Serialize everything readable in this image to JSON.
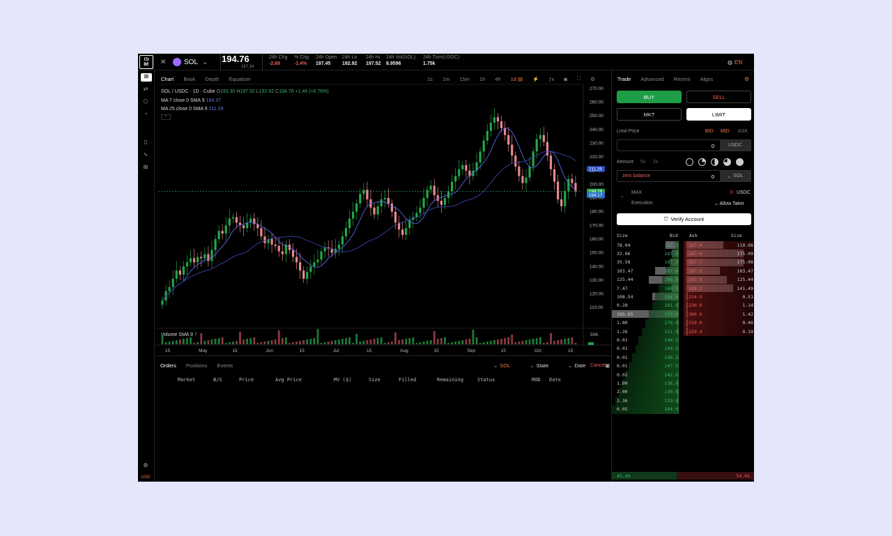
{
  "header": {
    "logo": "CU\nBE",
    "symbol": "SOL",
    "price": "194.76",
    "price_sub": "187.34",
    "lang": "EN",
    "stats": [
      {
        "label": "24h Chg",
        "value": "-2.69",
        "color": "#f05a5a"
      },
      {
        "label": "% Chg",
        "value": "-1.4%",
        "color": "#f05a5a"
      },
      {
        "label": "24h Open",
        "value": "197.45",
        "color": "#eeeeee"
      },
      {
        "label": "24h Lo",
        "value": "192.92",
        "color": "#eeeeee"
      },
      {
        "label": "24h Hi",
        "value": "197.52",
        "color": "#eeeeee"
      },
      {
        "label": "24h Vol(SOL)",
        "value": "8.9596",
        "color": "#eeeeee"
      },
      {
        "label": "24h Turn(USDC)",
        "value": "1.75k",
        "color": "#eeeeee"
      }
    ]
  },
  "chart_tabs": [
    "Chart",
    "Book",
    "Depth",
    "Equalizer"
  ],
  "timeframes": [
    "1s",
    "1m",
    "15m",
    "1h",
    "4h",
    "1d"
  ],
  "legend": {
    "pair": "SOL / USDC · 1D · Cube",
    "o": "193.30",
    "h": "197.52",
    "l": "192.92",
    "c": "194.76",
    "chg": "+1.46 (+0.76%)",
    "ma7": "MA 7 close 0 SMA 9",
    "ma7v": "194.37",
    "ma25": "MA 25 close 0 SMA 9",
    "ma25v": "211.29",
    "vol": "Volume SMA 9",
    "volv": "7"
  },
  "chart_data": {
    "type": "candlestick",
    "y_axis": [
      "270.00",
      "260.00",
      "250.00",
      "240.00",
      "230.00",
      "220.00",
      "210.00",
      "200.00",
      "190.00",
      "180.00",
      "170.00",
      "160.00",
      "150.00",
      "140.00",
      "130.00",
      "120.00",
      "110.00"
    ],
    "ylim": [
      105,
      271
    ],
    "x_labels": [
      "15",
      "May",
      "15",
      "Jun",
      "15",
      "Jul",
      "15",
      "Aug",
      "15",
      "Sep",
      "15",
      "Oct",
      "15"
    ],
    "price_tags": [
      "211.29",
      "194.76",
      "194.17"
    ],
    "vol_label": "50K",
    "closes": [
      115,
      122,
      125,
      131,
      137,
      134,
      140,
      143,
      146,
      143,
      147,
      146,
      149,
      144,
      152,
      160,
      166,
      164,
      170,
      175,
      176,
      172,
      170,
      168,
      172,
      175,
      171,
      168,
      162,
      157,
      160,
      156,
      155,
      151,
      149,
      156,
      152,
      147,
      143,
      137,
      131,
      136,
      140,
      143,
      145,
      151,
      154,
      153,
      150,
      153,
      156,
      162,
      168,
      175,
      180,
      186,
      193,
      196,
      189,
      183,
      178,
      184,
      189,
      190,
      186,
      180,
      172,
      167,
      163,
      168,
      174,
      176,
      179,
      183,
      190,
      196,
      199,
      192,
      188,
      185,
      190,
      195,
      202,
      206,
      211,
      214,
      210,
      206,
      210,
      216,
      224,
      232,
      239,
      245,
      249,
      246,
      241,
      236,
      229,
      221,
      213,
      206,
      201,
      205,
      213,
      224,
      233,
      236,
      231,
      221,
      211,
      202,
      189,
      184,
      195,
      204,
      201,
      195
    ]
  },
  "orders": {
    "tabs": [
      "Orders",
      "Positions",
      "Events"
    ],
    "filters": [
      "SOL",
      "State",
      "Date"
    ],
    "cancel": "Cancel",
    "columns": [
      "Market",
      "B/S",
      "Price",
      "Avg Price",
      "MV ($)",
      "Size",
      "Filled",
      "Remaining",
      "Status",
      "MOD",
      "Date"
    ]
  },
  "trade": {
    "tabs": [
      "Trade",
      "Advanced",
      "Recent",
      "Algos"
    ],
    "buy": "BUY",
    "sell": "SELL",
    "mkt": "MKT",
    "limit": "LIMIT",
    "limit_price": "Limit Price",
    "bid": "BID",
    "mid": "MID",
    "ask": "ASK",
    "price_val": "0",
    "price_unit": "USDC",
    "amount": "Amount",
    "x5": "5x",
    "x2": "2x",
    "zero_balance": "zero balance",
    "amount_val": "0",
    "amount_unit": "SOL",
    "max": "MAX",
    "max_val": "0",
    "max_unit": "USDC",
    "execution": "Execution",
    "allow_taker": "Allow Taker",
    "verify": "Verify Account"
  },
  "book": {
    "headers": [
      "Size",
      "Bid",
      "Ask",
      "Size"
    ],
    "bids": [
      [
        "78.04",
        "187.3",
        0.2
      ],
      [
        "32.06",
        "187.2",
        0.1
      ],
      [
        "35.58",
        "187.1",
        0.12
      ],
      [
        "103.47",
        "187.0",
        0.35
      ],
      [
        "125.44",
        "186.8",
        0.45
      ],
      [
        "7.47",
        "186.5",
        0.1
      ],
      [
        "108.54",
        "184.6",
        0.4
      ],
      [
        "0.28",
        "181.0",
        0.02
      ],
      [
        "195.65",
        "179.0",
        1.0
      ],
      [
        "1.80",
        "176.0",
        0.02
      ],
      [
        "1.26",
        "151.0",
        0.02
      ],
      [
        "0.01",
        "148.5",
        0.01
      ],
      [
        "0.01",
        "149.5",
        0.01
      ],
      [
        "0.01",
        "148.5",
        0.01
      ],
      [
        "0.01",
        "147.5",
        0.01
      ],
      [
        "0.01",
        "142.0",
        0.01
      ],
      [
        "1.00",
        "136.0",
        0.02
      ],
      [
        "2.00",
        "130.0",
        0.02
      ],
      [
        "2.36",
        "129.0",
        0.02
      ],
      [
        "0.05",
        "104.0",
        0.01
      ]
    ],
    "asks": [
      [
        "187.4",
        "110.06",
        0.55
      ],
      [
        "187.6",
        "175.09",
        0.85
      ],
      [
        "187.7",
        "175.08",
        0.85
      ],
      [
        "187.8",
        "103.47",
        0.5
      ],
      [
        "187.9",
        "125.44",
        0.6
      ],
      [
        "188.2",
        "141.49",
        0.7
      ],
      [
        "214.9",
        "0.51",
        0.02
      ],
      [
        "230.0",
        "1.14",
        0.02
      ],
      [
        "300.0",
        "1.42",
        0.02
      ],
      [
        "310.0",
        "0.46",
        0.02
      ],
      [
        "329.4",
        "0.19",
        0.02
      ]
    ],
    "bid_pct": "45.4%",
    "ask_pct": "54.6%"
  },
  "quote": "USD"
}
